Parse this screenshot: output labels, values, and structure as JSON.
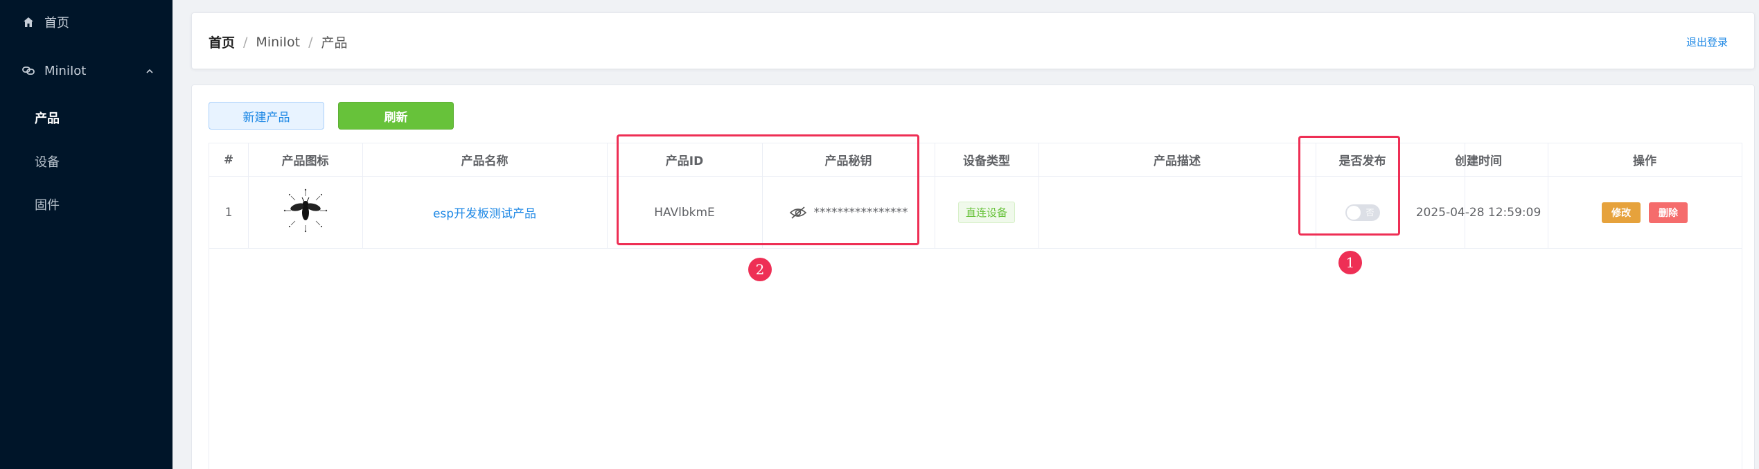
{
  "sidebar": {
    "items": [
      {
        "label": "首页",
        "icon": "home-icon"
      },
      {
        "label": "MiniIot",
        "icon": "chain-link-icon"
      }
    ],
    "sub_items": [
      {
        "label": "产品",
        "active": true
      },
      {
        "label": "设备",
        "active": false
      },
      {
        "label": "固件",
        "active": false
      }
    ],
    "colors": {
      "bg": "#001529",
      "text": "#c6ced8",
      "active": "#ffffff"
    }
  },
  "header": {
    "breadcrumb": [
      "首页",
      "MiniIot",
      "产品"
    ],
    "breadcrumb_sep": "/",
    "logout": "退出登录"
  },
  "toolbar": {
    "new_label": "新建产品",
    "refresh_label": "刷新"
  },
  "table": {
    "columns": [
      "#",
      "产品图标",
      "产品名称",
      "产品ID",
      "产品秘钥",
      "设备类型",
      "产品描述",
      "是否发布",
      "创建时间",
      "操作"
    ],
    "rows": [
      {
        "index": "1",
        "icon": "bee-icon",
        "name": "esp开发板测试产品",
        "product_id": "HAVlbkmE",
        "secret": "****************",
        "device_type": "直连设备",
        "description": "",
        "published": false,
        "published_text": "否",
        "created": "2025-04-28 12:59:09",
        "edit_label": "修改",
        "delete_label": "删除"
      }
    ]
  },
  "annotations": [
    {
      "number": "1",
      "target": "是否发布"
    },
    {
      "number": "2",
      "target": "产品ID / 产品秘钥"
    }
  ],
  "colors": {
    "accent": "#1e88e5",
    "success": "#67c23a",
    "warning": "#e6a23c",
    "danger": "#f56c6c",
    "annotation": "#ee2f55"
  }
}
